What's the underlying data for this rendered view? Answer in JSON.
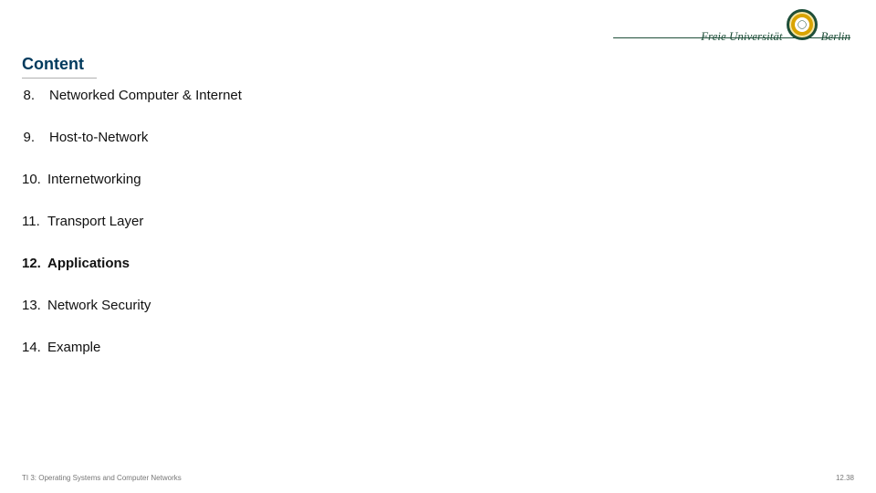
{
  "logo": {
    "word_left": "Freie Universität",
    "word_right": "Berlin"
  },
  "title": "Content",
  "items": [
    {
      "number": "8.",
      "label": "Networked Computer & Internet",
      "bold": false,
      "single": true
    },
    {
      "number": "9.",
      "label": "Host-to-Network",
      "bold": false,
      "single": true
    },
    {
      "number": "10.",
      "label": "Internetworking",
      "bold": false,
      "single": false
    },
    {
      "number": "11.",
      "label": "Transport Layer",
      "bold": false,
      "single": false
    },
    {
      "number": "12.",
      "label": "Applications",
      "bold": true,
      "single": false
    },
    {
      "number": "13.",
      "label": "Network Security",
      "bold": false,
      "single": false
    },
    {
      "number": "14.",
      "label": "Example",
      "bold": false,
      "single": false
    }
  ],
  "footer": {
    "left": "TI 3: Operating Systems and Computer Networks",
    "right": "12.38"
  }
}
